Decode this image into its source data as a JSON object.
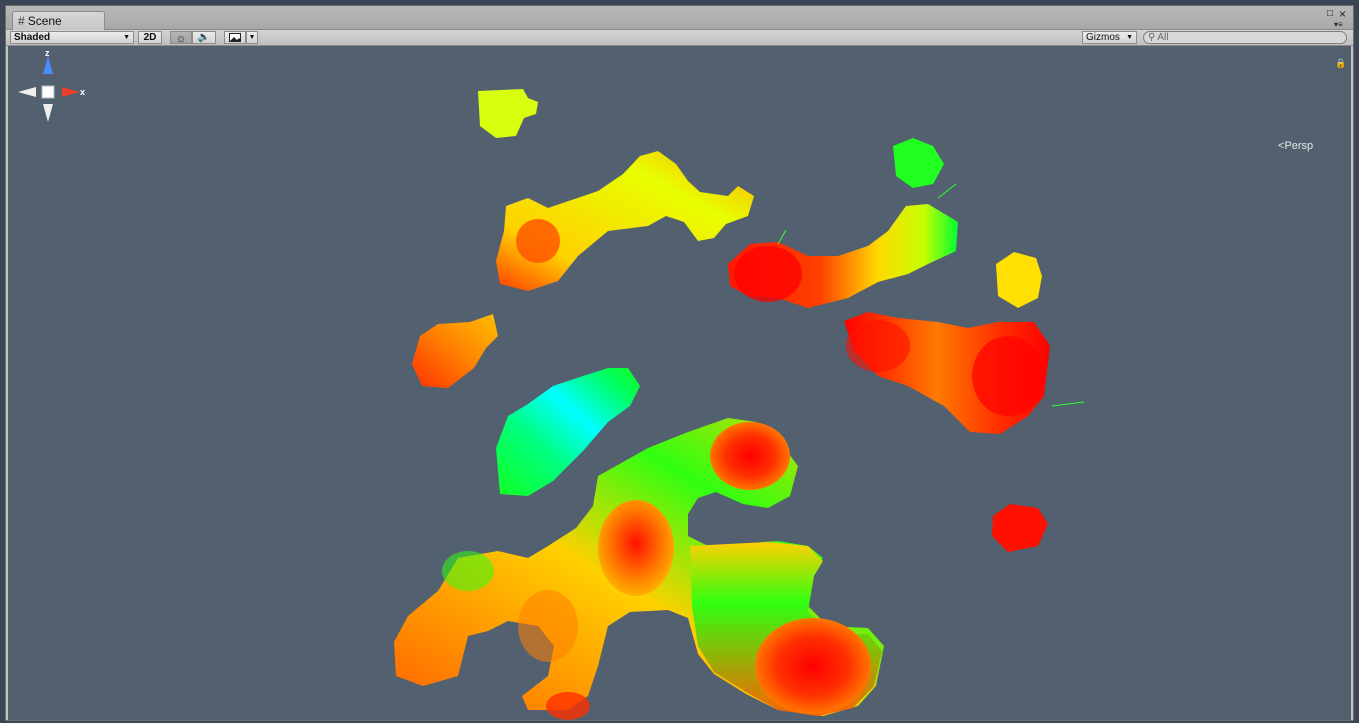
{
  "window": {
    "tab_label": "Scene",
    "tab_icon": "scene-grid-icon"
  },
  "toolbar": {
    "draw_mode": "Shaded",
    "btn_2d": "2D",
    "lighting_icon": "sun-icon",
    "audio_icon": "speaker-icon",
    "effects_icon": "image-icon",
    "gizmos_label": "Gizmos",
    "search_placeholder": "All"
  },
  "gizmo": {
    "axis_z": "z",
    "axis_x": "x",
    "projection": "Persp",
    "colors": {
      "z": "#4c8cff",
      "x": "#e8402a",
      "neutral": "#f0f0f0"
    }
  },
  "scene": {
    "background": "#526070",
    "palette": [
      "#ff0000",
      "#ff6a00",
      "#ffd200",
      "#c8ff00",
      "#00ff20",
      "#00ffff"
    ]
  }
}
